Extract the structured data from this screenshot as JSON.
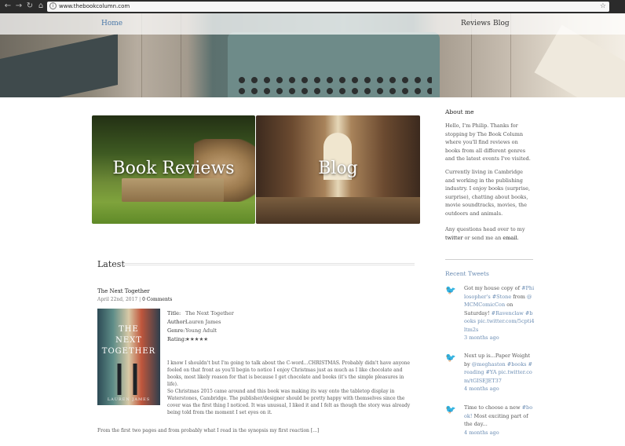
{
  "browser": {
    "url": "www.thebookcolumn.com",
    "back_icon": "←",
    "forward_icon": "→",
    "reload_icon": "↻",
    "home_icon": "⌂",
    "star_icon": "☆"
  },
  "nav": {
    "home": "Home",
    "reviews": "Reviews",
    "blog": "Blog"
  },
  "features": {
    "reviews_title": "Book Reviews",
    "blog_title": "Blog"
  },
  "latest": {
    "heading": "Latest",
    "post": {
      "title": "The Next Together",
      "date": "April 22nd, 2017",
      "separator": "|",
      "comments": "0 Comments",
      "info": {
        "title_label": "Title:",
        "title_value": "The Next Together",
        "author_label": "Author:",
        "author_value": "Lauren James",
        "genre_label": "Genre:",
        "genre_value": "Young Adult",
        "rating_label": "Rating:",
        "rating_value": "★★★★★"
      },
      "cover": {
        "title_line1": "THE",
        "title_line2": "NEXT",
        "title_line3": "TOGETHER",
        "author": "LAUREN JAMES"
      },
      "paragraph1": "I know I shouldn't but I'm going to talk about the C-word...CHRISTMAS. Probably didn't have anyone fooled on that front as you'll begin to notice I enjoy Christmas just as much as I like chocolate and books, most likely reason for that is because I get chocolate and books (it's the simple pleasures in life).",
      "paragraph2": "So Christmas 2015 came around and this book was making its way onto the tabletop display in Waterstones, Cambridge. The publisher/designer should be pretty happy with themselves since the cover was the first thing I noticed. It was unusual, I liked it and I felt as though the story was already being told from the moment I set eyes on it.",
      "excerpt": "From the first two pages and from probably what I read in the synopsis my first reaction [...]"
    }
  },
  "sidebar": {
    "about_heading": "About me",
    "about_p1": "Hello, I'm Philip. Thanks for stopping by The Book Column where you'll find reviews on books from all different genres and the latest events I've visited.",
    "about_p2": "Currently living in Cambridge and working in the publishing industry. I enjoy books (surprise, surprise), chatting about books, movie soundtracks, movies, the outdoors and animals.",
    "about_p3_pre": "Any questions head over to my",
    "about_p3_twitter": "twitter",
    "about_p3_mid": "or send me an",
    "about_p3_email": "email.",
    "tweets_heading": "Recent Tweets",
    "bird_icon": "🐦",
    "tweets": [
      {
        "text1": "Got my house copy of",
        "link1": "#Philosopher's #Stone",
        "text2": "from",
        "link2": "@MCMComicCon",
        "text3": "on Saturday!",
        "link3": "#Ravenclaw #books pic.twitter.com/5cpti4ltm2s",
        "time": "3 months ago"
      },
      {
        "text1": "Next up is...Paper Weight by",
        "link1": "@meghaston",
        "link2": "#books #reading #YA pic.twitter.com/tGISEJET37",
        "time": "4 months ago"
      },
      {
        "text1": "Time to choose a new",
        "link1": "#book!",
        "text2": "Most exciting part of the day...",
        "time": "4 months ago"
      }
    ]
  }
}
